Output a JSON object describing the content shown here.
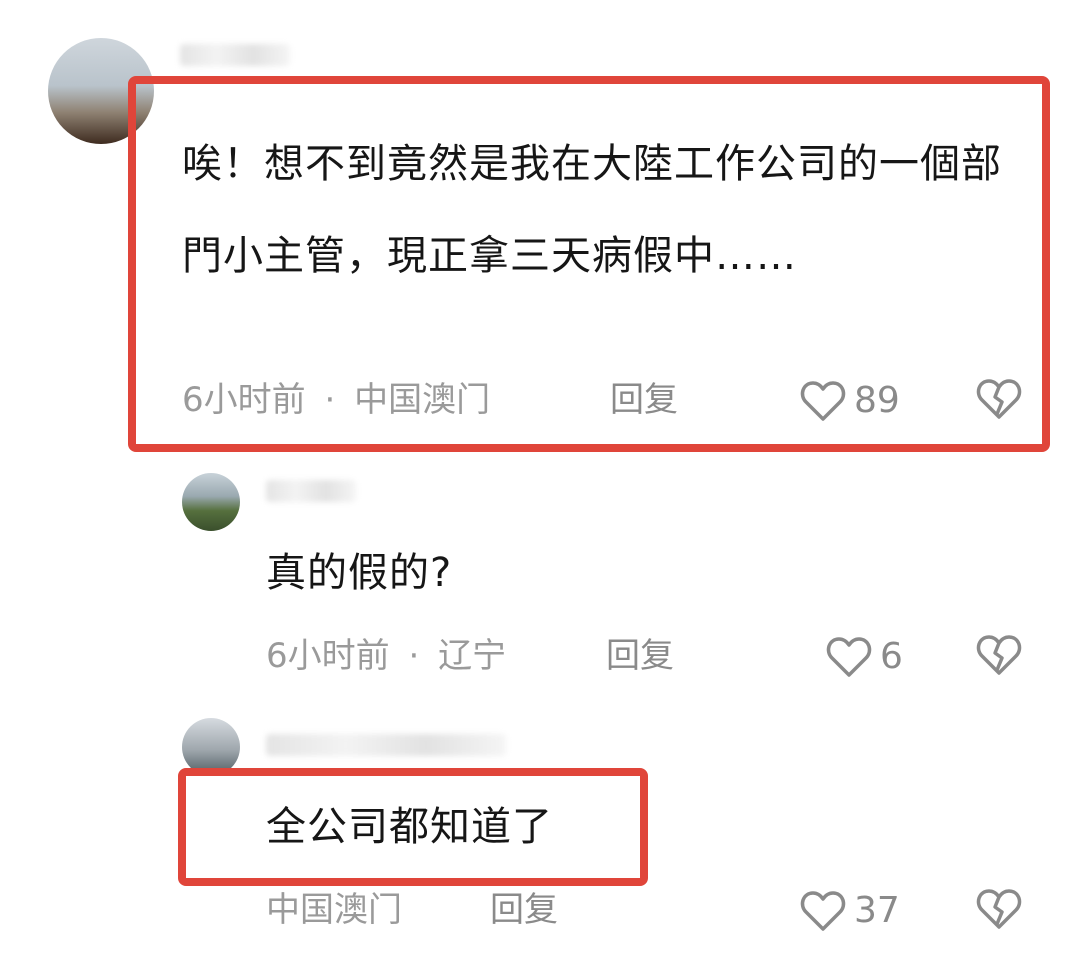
{
  "comments": [
    {
      "text": "唉！想不到竟然是我在大陸工作公司的一個部門小主管，現正拿三天病假中……",
      "time": "6小时前",
      "location": "中国澳门",
      "reply_label": "回复",
      "likes": "89",
      "highlighted": true
    },
    {
      "text": "真的假的?",
      "time": "6小时前",
      "location": "辽宁",
      "reply_label": "回复",
      "likes": "6",
      "highlighted": false
    },
    {
      "text": "全公司都知道了",
      "location": "中国澳门",
      "reply_label": "回复",
      "likes": "37",
      "highlighted": true
    }
  ],
  "separator": "·",
  "icons": {
    "like": "heart-outline-icon",
    "dislike": "broken-heart-icon"
  },
  "colors": {
    "highlight": "#e0453a",
    "meta": "#9a9a9a",
    "text": "#161616"
  }
}
